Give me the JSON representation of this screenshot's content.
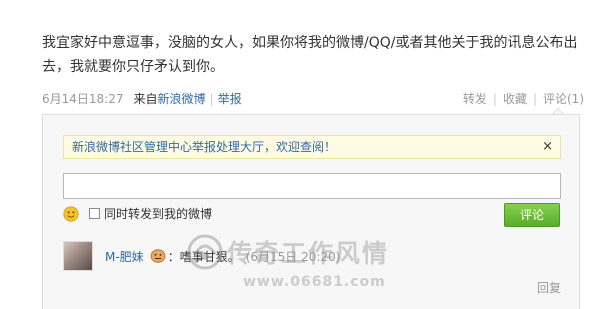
{
  "post": {
    "text": "我宜家好中意逗事，没脑的女人，如果你将我的微博/QQ/或者其他关于我的讯息公布出去，我就要你只仔矛认到你。"
  },
  "meta": {
    "time": "6月14日18:27",
    "source_prefix": "来自",
    "source": "新浪微博",
    "report": "举报",
    "forward": "转发",
    "favorite": "收藏",
    "comment": "评论(1)"
  },
  "comment_box": {
    "notice": "新浪微博社区管理中心举报处理大厅，欢迎查阅！",
    "close_symbol": "×",
    "input_value": "",
    "forward_label": "同时转发到我的微博",
    "submit_label": "评论"
  },
  "comments": [
    {
      "user": "M-肥妹",
      "text": "：嗜事甘狠。",
      "time": "(6月15日 20:20)",
      "reply_label": "回复"
    }
  ],
  "watermark": {
    "title": "传奇工作风情",
    "url": "www.06681.com"
  },
  "icons": {
    "smiley": "smiley-icon",
    "emoticon": "emoticon-face-icon",
    "watermark_logo": "watermark-logo-icon"
  },
  "colors": {
    "link": "#2f6aa7",
    "submit_button": "#6cbc3c",
    "notice_bg": "#fffbe3",
    "box_bg": "#f7f7f7"
  }
}
